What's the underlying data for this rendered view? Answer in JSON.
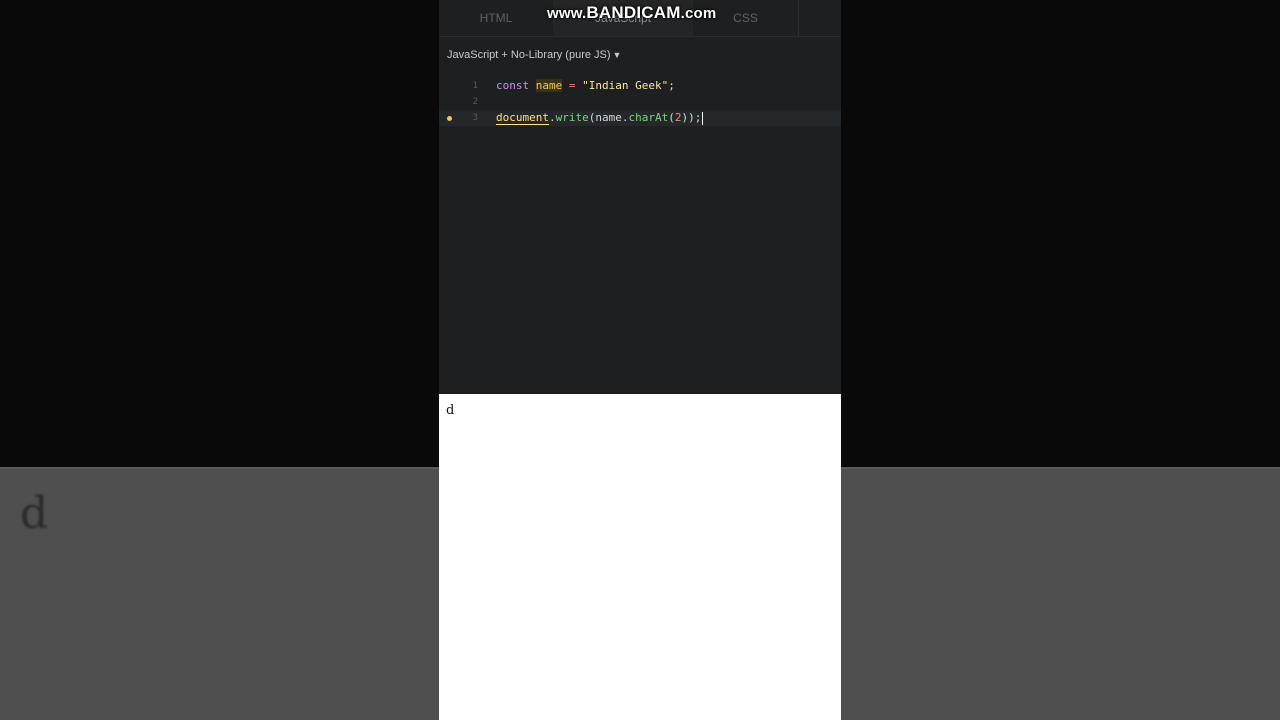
{
  "tabs": {
    "html": "HTML",
    "js": "JavaScript",
    "css": "CSS"
  },
  "watermark": {
    "pre": "www.",
    "brand": "BANDICAM",
    "post": ".com"
  },
  "language_selector": {
    "label": "JavaScript + No-Library (pure JS)",
    "caret": "▼"
  },
  "editor": {
    "lines": [
      {
        "number": "1",
        "tokens": [
          "const",
          " ",
          "name",
          " ",
          "=",
          " ",
          "\"Indian Geek\"",
          ";"
        ]
      },
      {
        "number": "2",
        "tokens": []
      },
      {
        "number": "3",
        "tokens": [
          "document",
          ".",
          "write",
          "(name.",
          "charAt",
          "(",
          "2",
          "));"
        ]
      }
    ],
    "warning_line": "3"
  },
  "output": {
    "text": "d"
  },
  "background_echo": "d",
  "colors": {
    "keyword": "#c792ea",
    "string": "#ffe7a0",
    "method": "#7ed37f",
    "warning": "#f2c94c",
    "editor_bg": "#1d1f20"
  }
}
